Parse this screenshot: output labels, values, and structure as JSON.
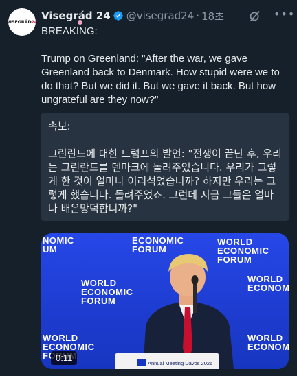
{
  "author": {
    "display_name": "Visegrád 24",
    "handle": "@visegrad24",
    "separator": "·",
    "time": "18초",
    "avatar_text_main": "VISEGRÁD",
    "avatar_text_accent": "24"
  },
  "tweet": {
    "text": "BREAKING:\n\nTrump on Greenland: \"After the war, we gave Greenland back to Denmark. How stupid were we to do that? But we did it. But we gave it back. But how ungrateful are they now?\""
  },
  "translation": {
    "text": "속보:\n\n그린란드에 대한 트럼프의 발언: \"전쟁이 끝난 후, 우리는 그린란드를 덴마크에 돌려주었습니다. 우리가 그렇게 한 것이 얼마나 어리석었습니까? 하지만 우리는 그렇게 했습니다. 돌려주었죠. 그런데 지금 그들은 얼마나 배은망덕합니까?\""
  },
  "media": {
    "duration": "0:11",
    "logo_lines": [
      "WORLD",
      "ECONOMIC",
      "FORUM"
    ],
    "logo_partial_left": [
      "NOMIC",
      "UM"
    ],
    "lectern_label": "Annual Meeting Davos 2026"
  },
  "colors": {
    "background": "#15202b",
    "verified": "#1d9bf0",
    "media_blue": "#1d3ccf"
  },
  "icons": {
    "verified": "verified-badge-icon",
    "grok": "grok-icon",
    "more": "more-icon"
  }
}
